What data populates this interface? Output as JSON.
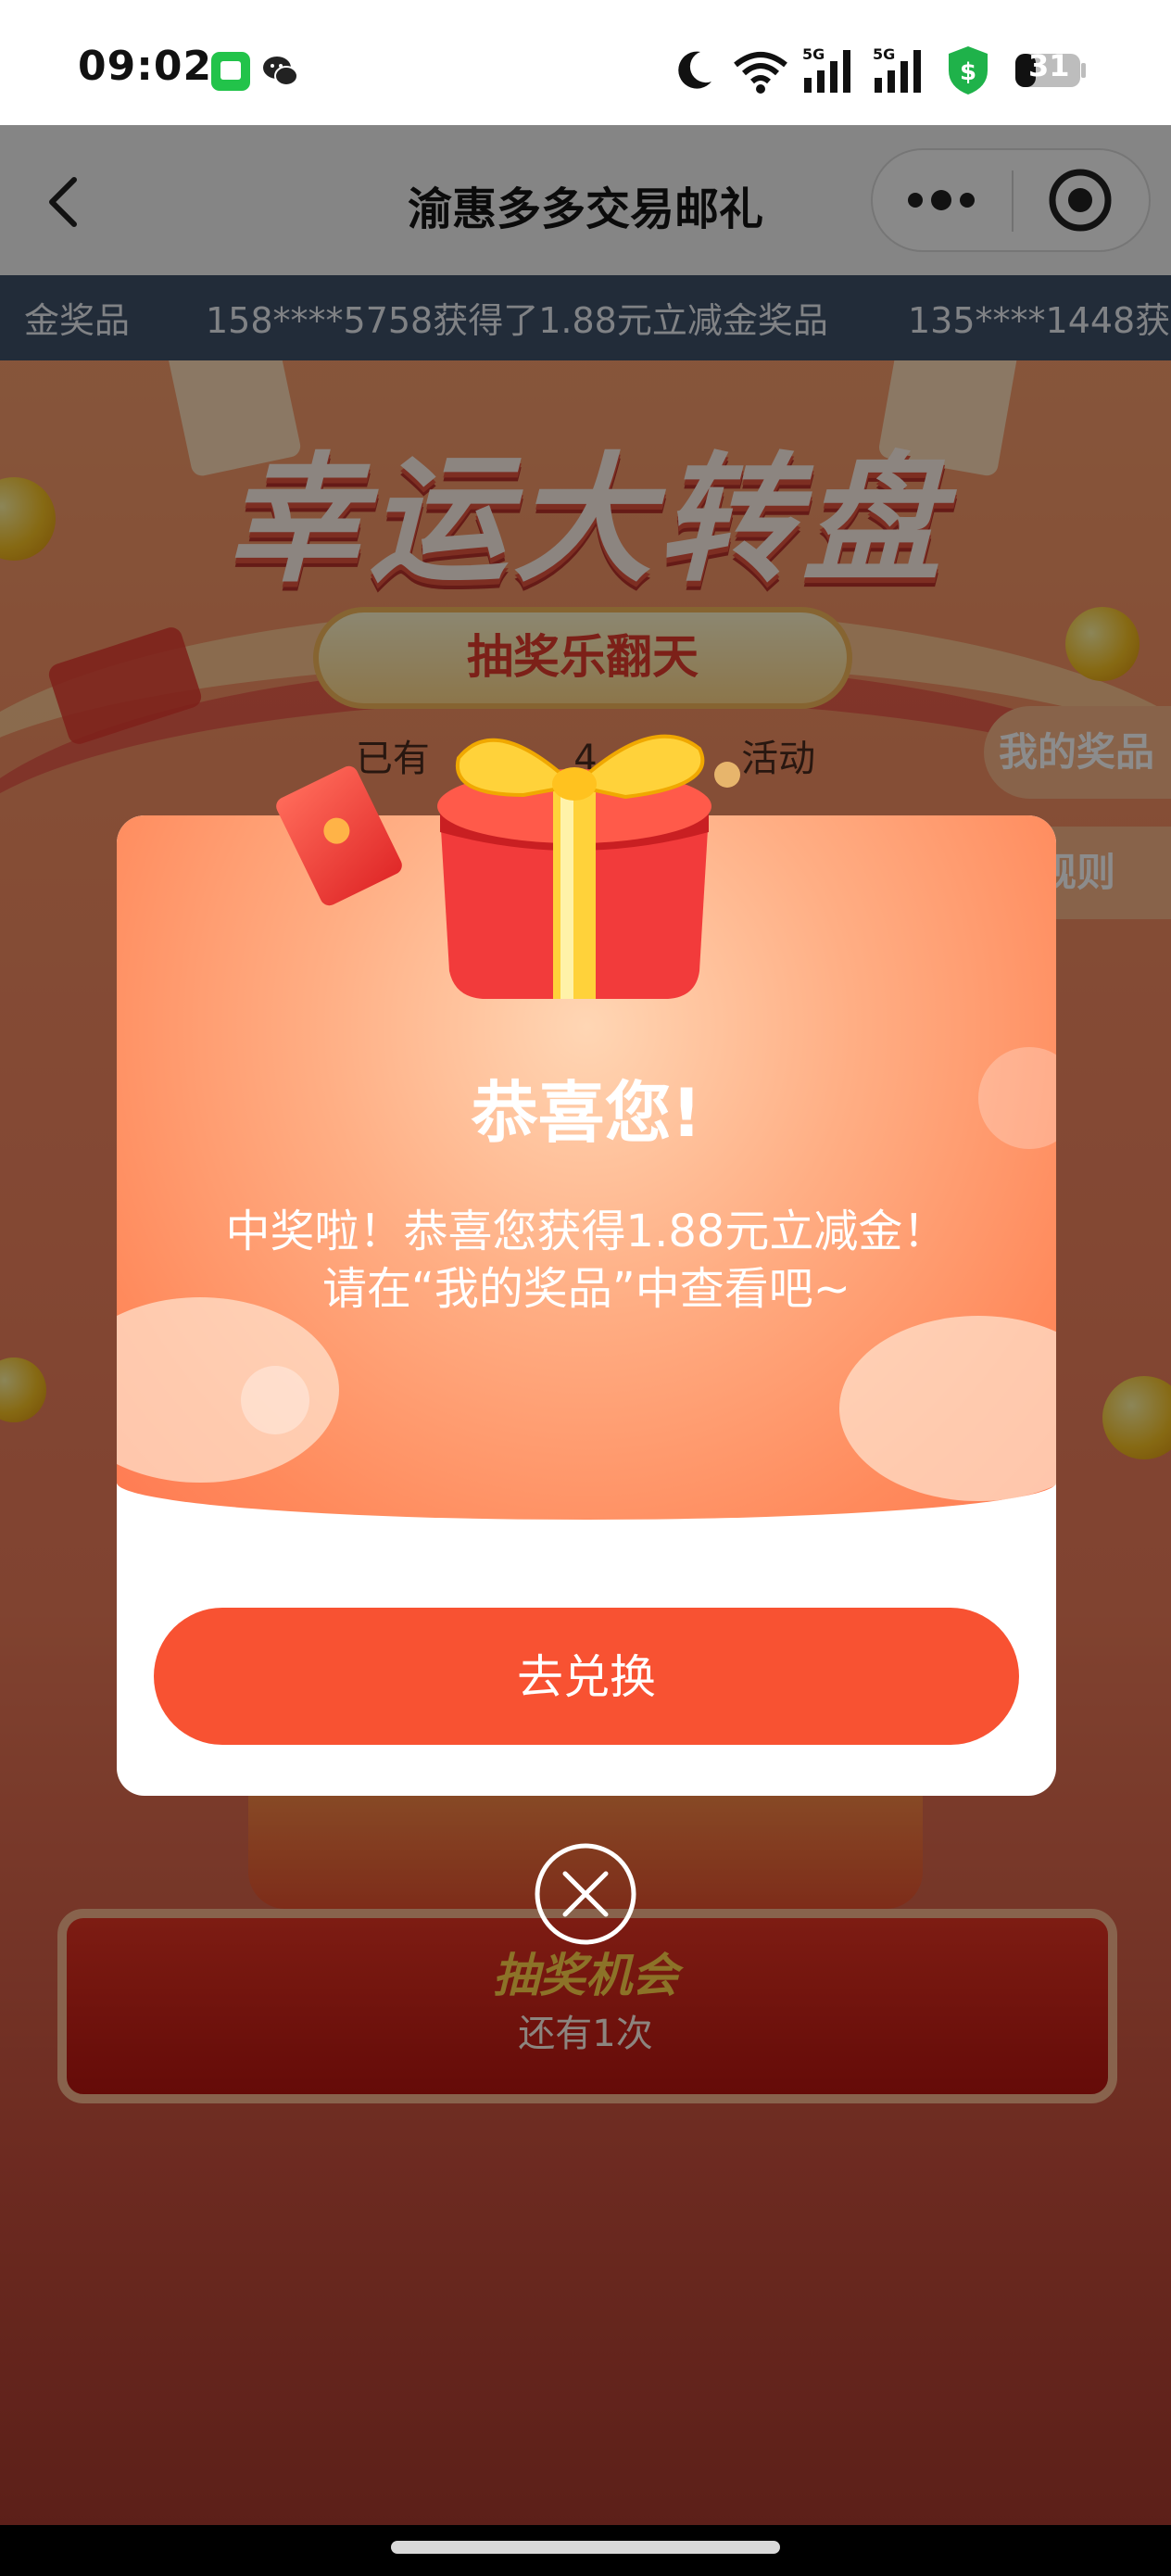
{
  "status_bar": {
    "time": "09:02",
    "battery": "31",
    "icons": [
      "messages-icon",
      "wechat-icon",
      "do-not-disturb-icon",
      "wifi-icon",
      "signal-5g-icon",
      "signal-5g-icon",
      "security-shield-icon",
      "battery-icon"
    ]
  },
  "nav": {
    "title": "渝惠多多交易邮礼",
    "back_icon": "chevron-left-icon",
    "more_icon": "more-dots-icon",
    "close_icon": "mini-program-close-icon"
  },
  "ticker": {
    "items": [
      "金奖品",
      "158****5758获得了1.88元立减金奖品",
      "135****1448获"
    ]
  },
  "banner": {
    "title": "幸运大转盘",
    "subtitle": "抽奖乐翻天",
    "participants_prefix": "已有",
    "participants_digit": "4",
    "participants_suffix": "活动"
  },
  "side_buttons": {
    "my_prizes": "我的奖品",
    "rules": "动规则"
  },
  "draw": {
    "title": "抽奖机会",
    "remaining": "还有1次"
  },
  "modal": {
    "title": "恭喜您!",
    "message_line1": "中奖啦！恭喜您获得1.88元立减金！",
    "message_line2": "请在“我的奖品”中查看吧~",
    "button": "去兑换",
    "close_icon": "close-circle-icon"
  },
  "colors": {
    "ticker_bg": "#3f5069",
    "modal_button": "#f85232",
    "modal_head": "#ff8a5c",
    "gift_box": "#f23b3b",
    "gift_ribbon": "#ffd23a"
  }
}
